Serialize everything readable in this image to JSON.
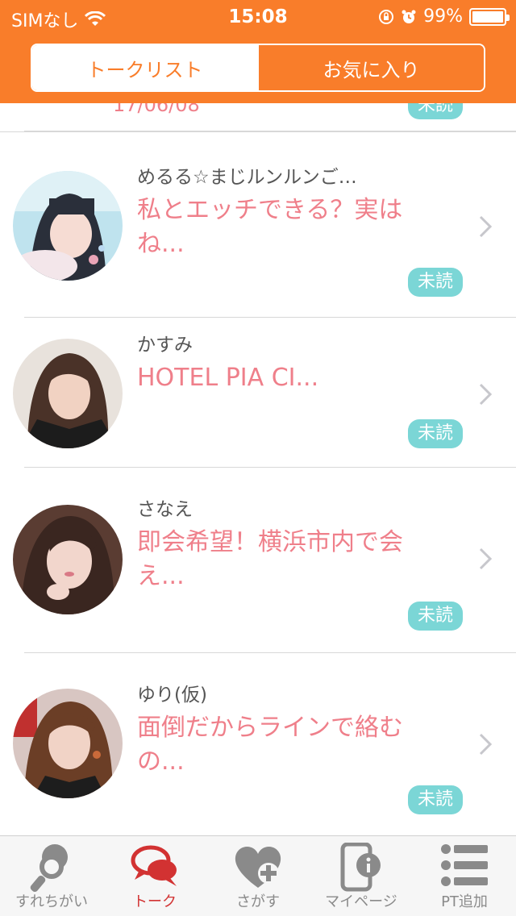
{
  "status_bar": {
    "carrier": "SIMなし",
    "time": "15:08",
    "battery": "99%",
    "battery_level": 0.99
  },
  "segment": {
    "tabs": [
      {
        "label": "トークリスト",
        "active": true
      },
      {
        "label": "お気に入り",
        "active": false
      }
    ]
  },
  "peek_item": {
    "date_partial": "17/06/08",
    "badge_partial": "未読"
  },
  "conversations": [
    {
      "name": "めるる☆まじルンルンご…",
      "message": "私とエッチできる？実はね...",
      "badge": "未読",
      "avatar_icon": "woman-photo-avatar"
    },
    {
      "name": "かすみ",
      "message": "HOTEL PIA CI...",
      "badge": "未読",
      "avatar_icon": "woman-photo-avatar"
    },
    {
      "name": "さなえ",
      "message": "即会希望！横浜市内で会え...",
      "badge": "未読",
      "avatar_icon": "woman-photo-avatar"
    },
    {
      "name": "ゆり(仮)",
      "message": "面倒だからラインで絡むの...",
      "badge": "未読",
      "avatar_icon": "woman-photo-avatar"
    }
  ],
  "tabbar": {
    "items": [
      {
        "label": "すれちがい",
        "icon": "pin-search-icon",
        "active": false
      },
      {
        "label": "トーク",
        "icon": "chat-bubbles-icon",
        "active": true
      },
      {
        "label": "さがす",
        "icon": "heart-plus-icon",
        "active": false
      },
      {
        "label": "マイページ",
        "icon": "phone-info-icon",
        "active": false
      },
      {
        "label": "PT追加",
        "icon": "list-icon",
        "active": false
      }
    ]
  },
  "colors": {
    "header": "#f97d2a",
    "message": "#ef7f8a",
    "badge": "#7bd6d6",
    "tab_active": "#d23232",
    "tab_inactive": "#8a8a8a"
  }
}
